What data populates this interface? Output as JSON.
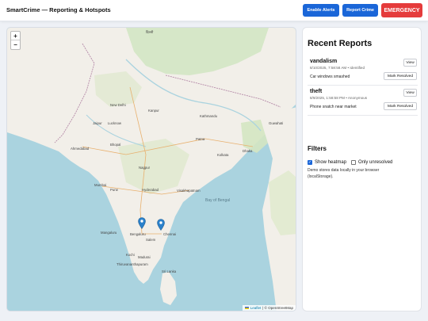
{
  "header": {
    "title": "SmartCrime — Reporting & Hotspots",
    "buttons": {
      "enable_alerts": "Enable Alerts",
      "report_crime": "Report Crime",
      "emergency": "EMERGENCY"
    }
  },
  "map": {
    "zoom_in": "+",
    "zoom_out": "−",
    "attribution": {
      "leaflet": "Leaflet",
      "separator": " | © OpenStreetMap"
    },
    "labels": {
      "lucknow": "Lucknow",
      "kanpur": "Kanpur",
      "patna": "Patna",
      "kolkata": "Kolkata",
      "ahmedabad": "Ahmedabad",
      "bhopal": "Bhopal",
      "nagpur": "Nagpur",
      "mumbai": "Mumbai",
      "pune": "Pune",
      "hyderabad": "Hyderabad",
      "visakhapatnam": "Visakhapatnam",
      "bengaluru": "Bengaluru",
      "chennai": "Chennai",
      "kochi": "Kochi",
      "madurai": "Madurai",
      "bay_of_bengal": "Bay of Bengal",
      "sri_lanka": "Sri Lanka",
      "new_delhi": "New Delhi",
      "jaipur": "Jaipur",
      "mangaluru": "Mangaluru",
      "salem": "Salem",
      "thiruvananthapuram": "Thiruvananthapuram",
      "kathmandu": "Kathmandu",
      "guwahati": "Guwahati",
      "dhaka": "Dhaka"
    },
    "marker_count": 2,
    "colors": {
      "water": "#aad3df",
      "land": "#f2efe9",
      "marker": "#2a81cb"
    }
  },
  "panel": {
    "title": "Recent Reports",
    "reports": [
      {
        "type": "vandalism",
        "meta": "8/10/2025, 7:58:58 AM • Identified",
        "description": "Car windows smashed",
        "view": "View",
        "resolve": "Mark Resolved"
      },
      {
        "type": "theft",
        "meta": "8/9/2025, 1:58:58 PM • Anonymous",
        "description": "Phone snatch near market",
        "view": "View",
        "resolve": "Mark Resolved"
      }
    ],
    "filters": {
      "title": "Filters",
      "show_heatmap": "Show heatmap",
      "show_heatmap_checked": true,
      "only_unresolved": "Only unresolved",
      "only_unresolved_checked": false,
      "note": "Demo stores data locally in your browser (localStorage)."
    }
  }
}
